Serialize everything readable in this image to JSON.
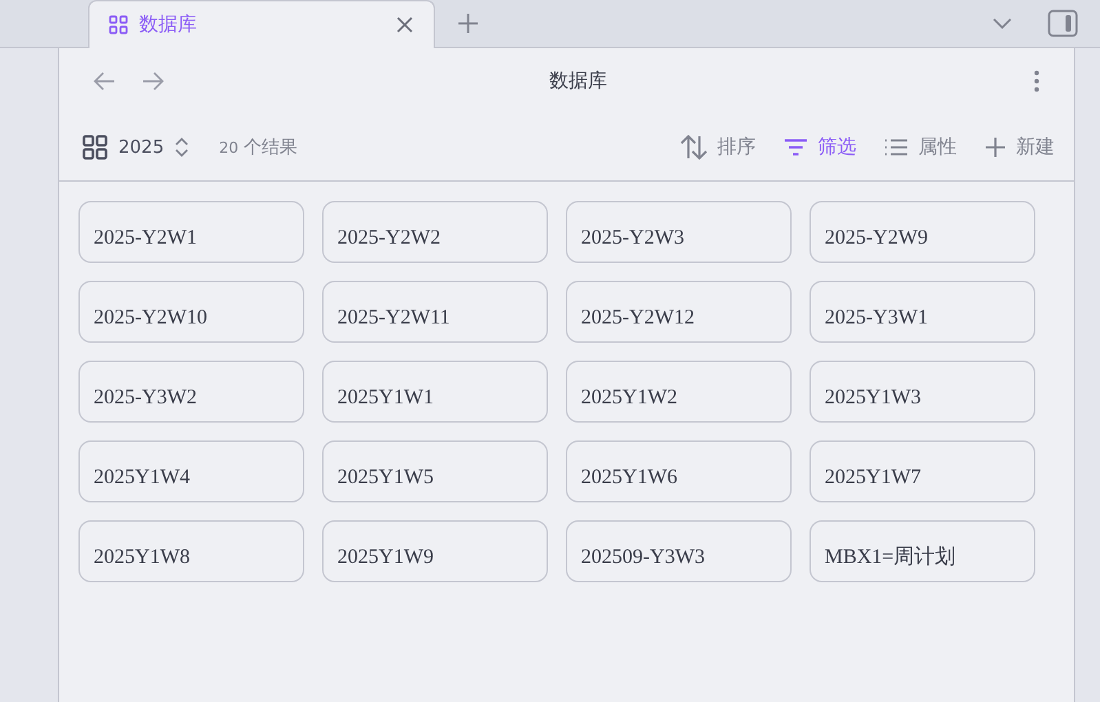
{
  "tab": {
    "title": "数据库",
    "selected": true
  },
  "header": {
    "title": "数据库"
  },
  "view": {
    "name": "2025",
    "count": "20",
    "count_label": "个结果"
  },
  "actions": [
    {
      "kind": "sort",
      "label": "排序",
      "active": false
    },
    {
      "kind": "filter",
      "label": "筛选",
      "active": true
    },
    {
      "kind": "properties",
      "label": "属性",
      "active": false
    },
    {
      "kind": "new",
      "label": "新建",
      "active": false
    }
  ],
  "cards": [
    "2025-Y2W1",
    "2025-Y2W2",
    "2025-Y2W3",
    "2025-Y2W9",
    "2025-Y2W10",
    "2025-Y2W11",
    "2025-Y2W12",
    "2025-Y3W1",
    "2025-Y3W2",
    "2025Y1W1",
    "2025Y1W2",
    "2025Y1W3",
    "2025Y1W4",
    "2025Y1W5",
    "2025Y1W6",
    "2025Y1W7",
    "2025Y1W8",
    "2025Y1W9",
    "202509-Y3W3",
    "MBX1=周计划"
  ]
}
